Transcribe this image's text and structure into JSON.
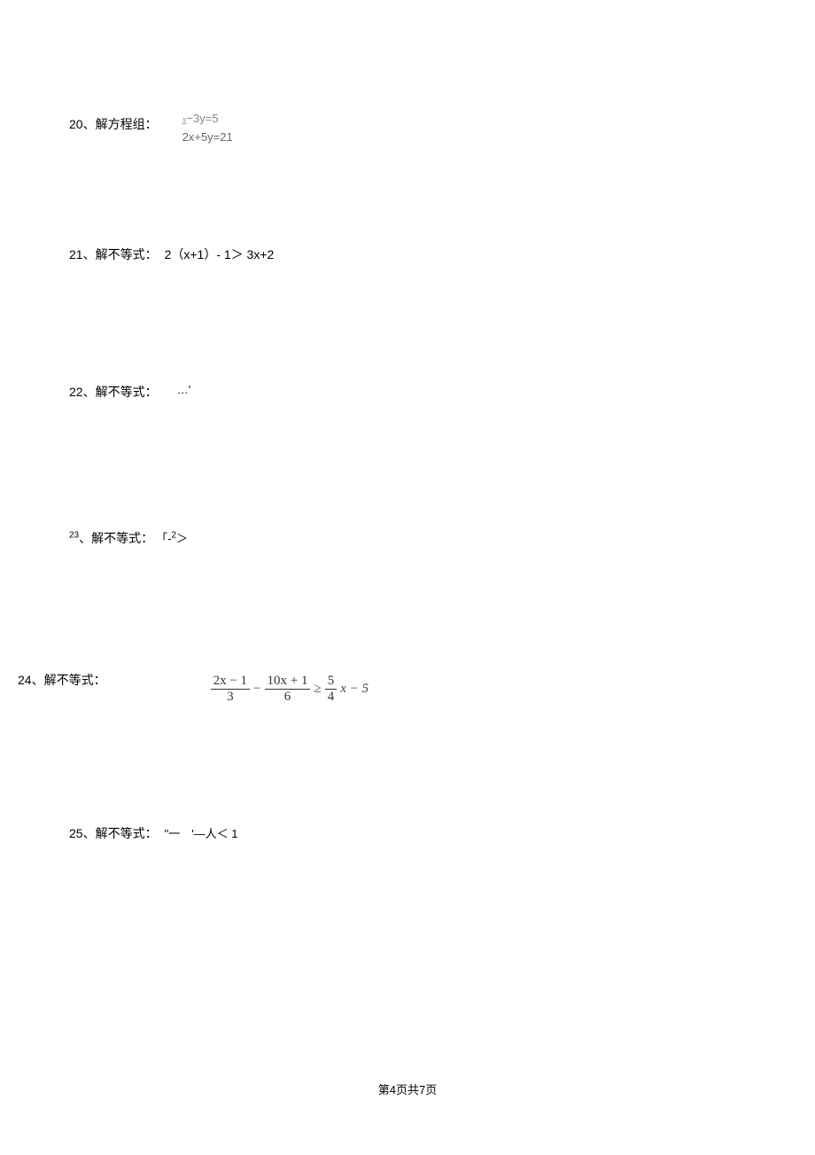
{
  "problems": {
    "p20": {
      "label": "20、解方程组：",
      "eq1_pre": "x",
      "eq1": "−3y=5",
      "eq2": "2x+5y=21"
    },
    "p21": {
      "label": "21、解不等式：",
      "expr": "2（x+1）- 1＞ 3x+2"
    },
    "p22": {
      "label": "22、解不等式：",
      "expr": "…'"
    },
    "p23": {
      "label_num": "23",
      "label_text": "、解不等式：",
      "expr_pre": "「-",
      "expr_sup": "2",
      "expr_post": "＞"
    },
    "p24": {
      "label": "24、解不等式：",
      "frac1_num": "2x − 1",
      "frac1_den": "3",
      "op1": "−",
      "frac2_num": "10x + 1",
      "frac2_den": "6",
      "op2": "≥",
      "frac3_num": "5",
      "frac3_den": "4",
      "tail": "x − 5"
    },
    "p25": {
      "label": "25、解不等式：",
      "expr": "\"一　'—人＜ 1"
    }
  },
  "footer": {
    "pre": "第",
    "cur": "4",
    "mid": "页共",
    "total": "7",
    "post": "页"
  }
}
